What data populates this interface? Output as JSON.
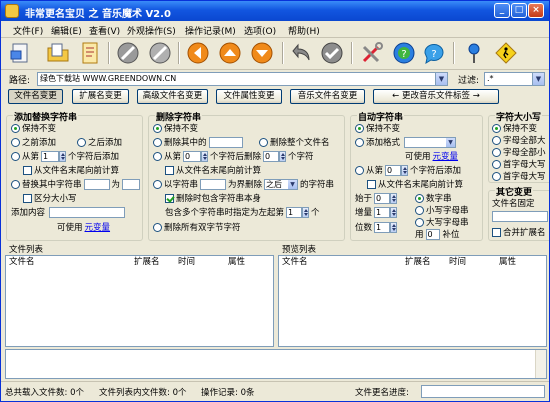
{
  "window": {
    "title": "非常更名宝贝 之 音乐魔术 V2.0"
  },
  "menu": [
    "文件(F)",
    "编辑(E)",
    "查看(V)",
    "外观操作(S)",
    "操作记录(M)",
    "选项(O)",
    "帮助(H)"
  ],
  "toolbar": {
    "icons": [
      "open-file-icon",
      "open-folder-icon",
      "document-icon",
      "stop-icon",
      "cancel-icon",
      "arrow-left-icon",
      "arrow-up-icon",
      "arrow-down-icon",
      "undo-icon",
      "confirm-icon",
      "tools-icon",
      "help-icon",
      "hint-icon",
      "pin-icon",
      "walk-icon"
    ]
  },
  "pathbar": {
    "path_label": "路径:",
    "path_value": "绿色下载站 WWW.GREENDOWN.CN",
    "filter_label": "过滤:",
    "filter_value": ".*"
  },
  "mode_buttons": [
    "文件名变更",
    "扩展名变更",
    "高级文件名变更",
    "文件属性变更",
    "音乐文件名变更",
    "← 更改音乐文件标签 →"
  ],
  "add_group": {
    "title": "添加替换字符串",
    "keep": "保持不变",
    "prepend": "之前添加",
    "append": "之后添加",
    "from_nth": "从第",
    "nth_value": "1",
    "after_char": "个字符后添加",
    "from_end": "从文件名末尾向前计算",
    "replace": "替换其中字符串",
    "replace_as": "为",
    "case": "区分大小写",
    "add_content": "添加内容",
    "available": "可使用",
    "variables": "元变量"
  },
  "delete_group": {
    "title": "删除字符串",
    "keep": "保持不变",
    "delete_in": "删除其中的",
    "delete_all": "删除整个文件名",
    "from_nth": "从第",
    "nth_value": "0",
    "after_del": "个字符后删除",
    "count_value": "0",
    "chars": "个字符",
    "from_end": "从文件名末尾向前计算",
    "by_str": "以字符串",
    "as_boundary": "为界删除",
    "direction": "之后",
    "chars2": "的字符串",
    "include_self": "删除时包含字符串本身",
    "include_n": "包含多个字符串时指定为左起第",
    "n_value": "1",
    "n_unit": "个",
    "all_double": "删除所有双字节字符"
  },
  "auto_group": {
    "title": "自动字符串",
    "keep": "保持不变",
    "add_format": "添加格式",
    "available": "可使用",
    "variables": "元变量",
    "from_nth": "从第",
    "nth_value": "0",
    "after_add": "个字符后添加",
    "from_end": "从文件名末尾向前计算",
    "start_label": "始于",
    "start_value": "0",
    "incr_label": "增量",
    "incr_value": "1",
    "digits_label": "位数",
    "digits_value": "1",
    "num_char": "数字串",
    "lower_char": "小写字母串",
    "upper_char": "大写字母串",
    "use_label": "用",
    "use_value": "0",
    "pad_label": "补位"
  },
  "case_group": {
    "title": "字符大小写",
    "keep": "保持不变",
    "all_upper": "字母全部大",
    "all_lower": "字母全部小",
    "first_upper": "首字母大写",
    "first_upper2": "首字母大写"
  },
  "other_group": {
    "title": "其它变更",
    "fixed_label": "文件名固定",
    "merge_ext": "合并扩展名"
  },
  "file_list": {
    "label": "文件列表",
    "columns": [
      "文件名",
      "扩展名",
      "时间",
      "属性"
    ]
  },
  "preview_list": {
    "label": "预览列表",
    "columns": [
      "文件名",
      "扩展名",
      "时间",
      "属性"
    ]
  },
  "status": {
    "total": "总共载入文件数: 0个",
    "list_count": "文件列表内文件数: 0个",
    "ops": "操作记录: 0条",
    "progress_label": "文件更名进度:"
  },
  "colors": {
    "title_bar": "#0a47d0",
    "window_bg": "#ece9d8",
    "link": "#0000ee"
  }
}
